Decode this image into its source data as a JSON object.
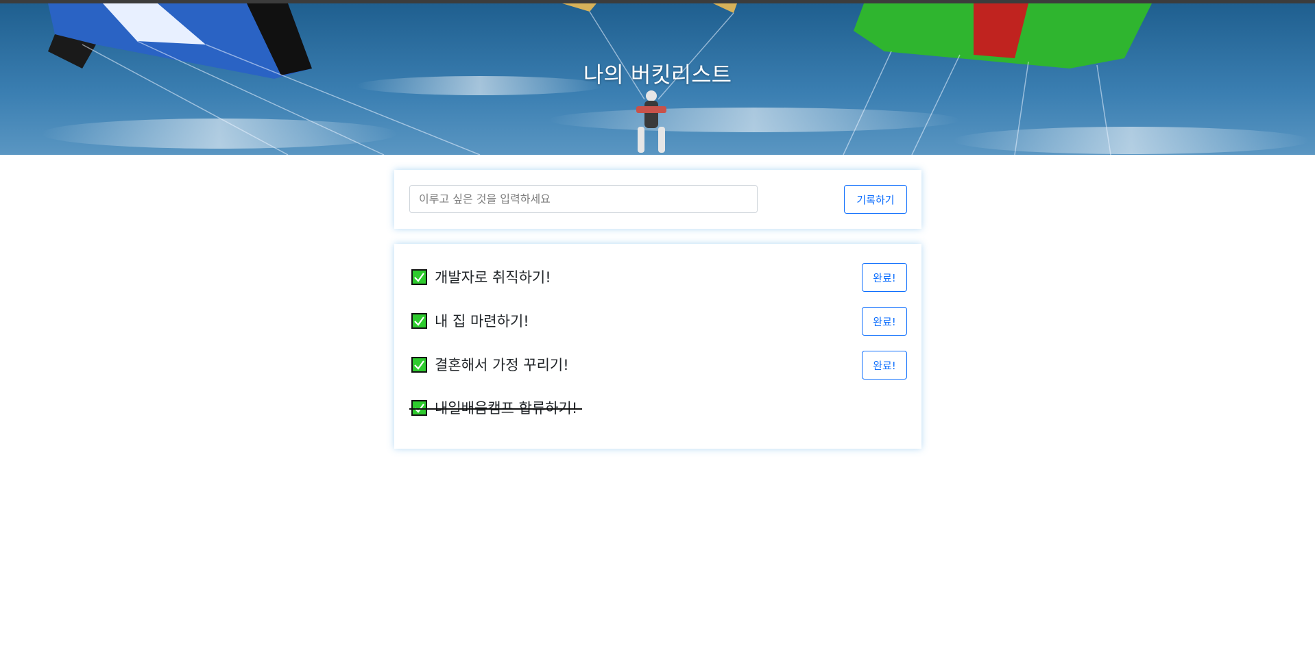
{
  "header": {
    "title": "나의 버킷리스트"
  },
  "form": {
    "placeholder": "이루고 싶은 것을 입력하세요",
    "value": "",
    "submit_label": "기록하기"
  },
  "buckets": [
    {
      "text": "개발자로 취직하기!",
      "done": false,
      "button_label": "완료!"
    },
    {
      "text": "내 집 마련하기!",
      "done": false,
      "button_label": "완료!"
    },
    {
      "text": "결혼해서 가정 꾸리기!",
      "done": false,
      "button_label": "완료!"
    },
    {
      "text": "내일배움캠프 합류하기!",
      "done": true,
      "button_label": ""
    }
  ],
  "colors": {
    "accent": "#0d6efd",
    "check": "#2ecb2e",
    "card_shadow": "#5aaae6"
  },
  "icons": {
    "check": "check-icon"
  }
}
